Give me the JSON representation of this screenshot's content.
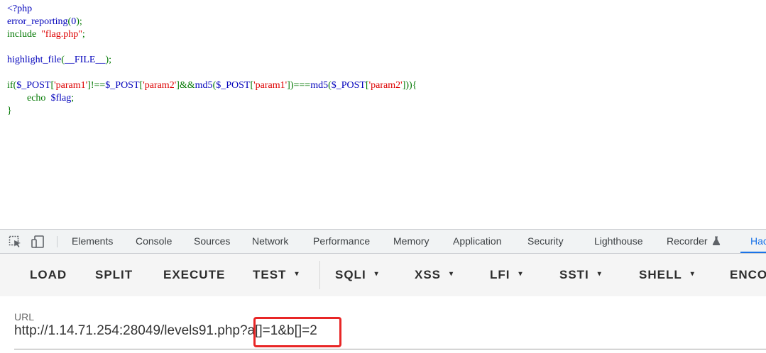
{
  "code_lines": [
    [
      {
        "t": "<?php",
        "c": "def"
      }
    ],
    [
      {
        "t": "error_reporting",
        "c": "def"
      },
      {
        "t": "(",
        "c": "kw"
      },
      {
        "t": "0",
        "c": "def"
      },
      {
        "t": ");",
        "c": "kw"
      }
    ],
    [
      {
        "t": "include  ",
        "c": "kw"
      },
      {
        "t": "\"flag.php\"",
        "c": "str"
      },
      {
        "t": ";",
        "c": "kw"
      }
    ],
    [],
    [
      {
        "t": "highlight_file",
        "c": "def"
      },
      {
        "t": "(",
        "c": "kw"
      },
      {
        "t": "__FILE__",
        "c": "def"
      },
      {
        "t": ");",
        "c": "kw"
      }
    ],
    [],
    [
      {
        "t": "if(",
        "c": "kw"
      },
      {
        "t": "$_POST",
        "c": "def"
      },
      {
        "t": "[",
        "c": "kw"
      },
      {
        "t": "'param1'",
        "c": "str"
      },
      {
        "t": "]!==",
        "c": "kw"
      },
      {
        "t": "$_POST",
        "c": "def"
      },
      {
        "t": "[",
        "c": "kw"
      },
      {
        "t": "'param2'",
        "c": "str"
      },
      {
        "t": "]&&",
        "c": "kw"
      },
      {
        "t": "md5",
        "c": "def"
      },
      {
        "t": "(",
        "c": "kw"
      },
      {
        "t": "$_POST",
        "c": "def"
      },
      {
        "t": "[",
        "c": "kw"
      },
      {
        "t": "'param1'",
        "c": "str"
      },
      {
        "t": "])===",
        "c": "kw"
      },
      {
        "t": "md5",
        "c": "def"
      },
      {
        "t": "(",
        "c": "kw"
      },
      {
        "t": "$_POST",
        "c": "def"
      },
      {
        "t": "[",
        "c": "kw"
      },
      {
        "t": "'param2'",
        "c": "str"
      },
      {
        "t": "])){",
        "c": "kw"
      }
    ],
    [
      {
        "t": "        echo  ",
        "c": "kw"
      },
      {
        "t": "$flag",
        "c": "def"
      },
      {
        "t": ";",
        "c": "kw"
      }
    ],
    [
      {
        "t": "}",
        "c": "kw"
      }
    ]
  ],
  "devtools": {
    "icons": [
      "inspect-icon",
      "device-toggle-icon"
    ],
    "tabs": [
      "Elements",
      "Console",
      "Sources",
      "Network",
      "Performance",
      "Memory",
      "Application",
      "Security",
      "Lighthouse",
      "Recorder",
      "Hac"
    ],
    "recorder_icon": "flask-icon",
    "active_tab": "Hac"
  },
  "hackbar": {
    "buttons": [
      "LOAD",
      "SPLIT",
      "EXECUTE",
      "TEST",
      "SQLI",
      "XSS",
      "LFI",
      "SSTI",
      "SHELL",
      "ENCO"
    ],
    "dropdown_buttons": [
      "TEST",
      "SQLI",
      "XSS",
      "LFI",
      "SSTI",
      "SHELL"
    ],
    "caret_icon": "▾"
  },
  "url": {
    "label": "URL",
    "base": "http://1.14.71.254:28049/levels91.php",
    "query": "?a[]=1&b[]=2",
    "highlight_color": "#e82626"
  }
}
